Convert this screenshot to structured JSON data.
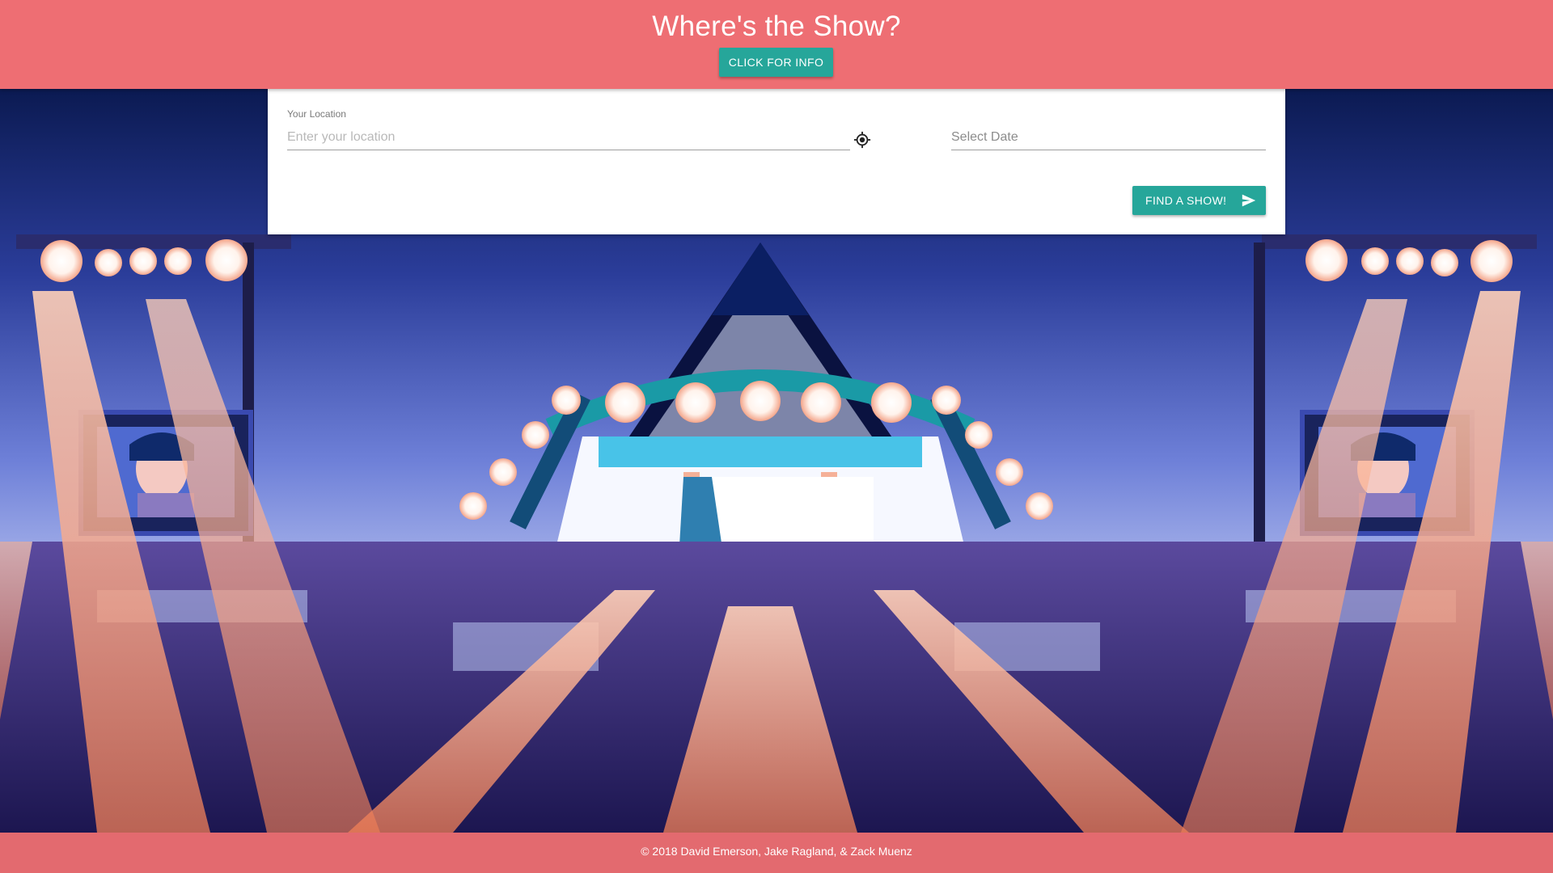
{
  "header": {
    "title": "Where's the Show?",
    "info_button_label": "CLICK FOR INFO"
  },
  "search": {
    "location_label": "Your Location",
    "location_placeholder": "Enter your location",
    "location_value": "",
    "locate_icon": "crosshair-gps-icon",
    "date_placeholder": "Select Date",
    "date_value": "",
    "submit_label": "FIND A SHOW!",
    "submit_icon": "send-icon"
  },
  "footer": {
    "copyright": "© 2018 David Emerson, Jake Ragland, & Zack Muenz"
  },
  "colors": {
    "header_bg": "#ee6e73",
    "footer_bg": "#e36a6f",
    "button_bg": "#26a69a"
  },
  "background": {
    "description_icon": "concert-stage-pixel-art"
  }
}
